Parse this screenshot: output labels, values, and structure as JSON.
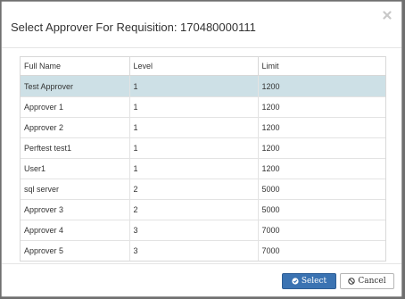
{
  "dialog": {
    "title": "Select Approver For Requisition: 170480000111",
    "close_icon": "close-icon"
  },
  "table": {
    "headers": [
      "Full Name",
      "Level",
      "Limit"
    ],
    "rows": [
      {
        "name": "Test Approver",
        "level": "1",
        "limit": "1200",
        "selected": true
      },
      {
        "name": "Approver 1",
        "level": "1",
        "limit": "1200"
      },
      {
        "name": "Approver 2",
        "level": "1",
        "limit": "1200"
      },
      {
        "name": "Perftest test1",
        "level": "1",
        "limit": "1200"
      },
      {
        "name": "User1",
        "level": "1",
        "limit": "1200"
      },
      {
        "name": "sql server",
        "level": "2",
        "limit": "5000"
      },
      {
        "name": "Approver 3",
        "level": "2",
        "limit": "5000"
      },
      {
        "name": "Approver 4",
        "level": "3",
        "limit": "7000"
      },
      {
        "name": "Approver 5",
        "level": "3",
        "limit": "7000"
      }
    ]
  },
  "footer": {
    "select_label": "Select",
    "cancel_label": "Cancel",
    "select_icon": "check-circle-icon",
    "cancel_icon": "ban-icon"
  },
  "colors": {
    "selected_row": "#cde0e6",
    "primary_button": "#3b73b2"
  }
}
